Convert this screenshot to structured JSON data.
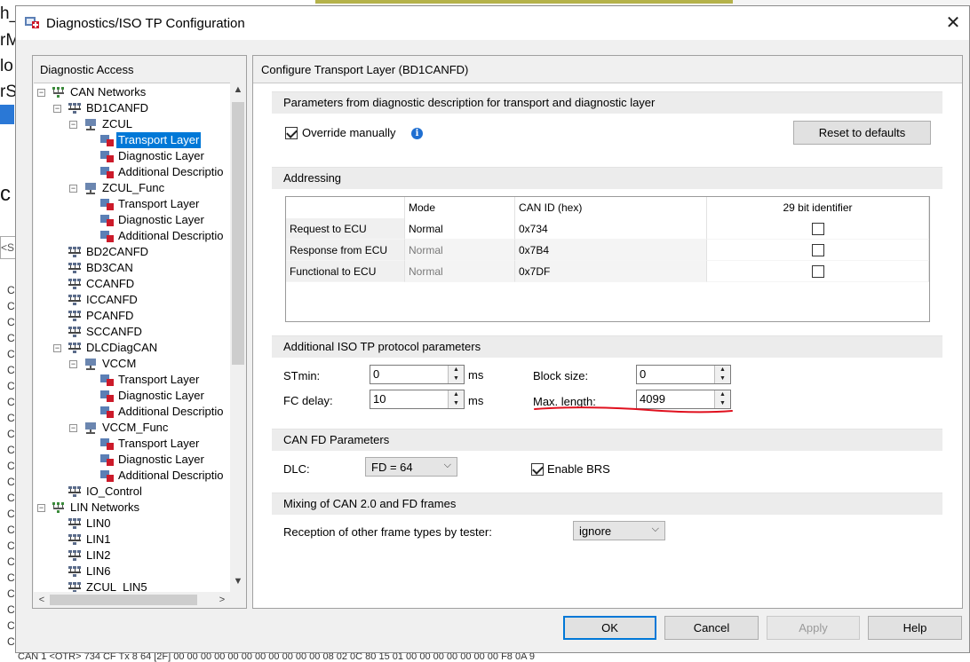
{
  "background": {
    "left_fragments": [
      "h_",
      "rM",
      "lo",
      "rS",
      "c"
    ],
    "combo_fragment": "<S",
    "row_prefix": "C",
    "bottom_row": "CAN 1    <OTR>           734              CF              Tx     8      64     [2F] 00 00 00 00 00 00 00 00 00 00 00 08 02 0C 80 15 01 00 00 00 00 00 00 00 F8 0A 9"
  },
  "dialog": {
    "title": "Diagnostics/ISO TP Configuration",
    "close_glyph": "✕"
  },
  "left_panel": {
    "header": "Diagnostic Access",
    "tree": [
      {
        "label": "CAN Networks",
        "icon": "network-icon",
        "expander": "-"
      },
      {
        "label": "BD1CANFD",
        "icon": "bus-icon",
        "expander": "-"
      },
      {
        "label": "ZCUL",
        "icon": "ecu-icon",
        "expander": "-"
      },
      {
        "label": "Transport Layer",
        "icon": "layer-icon",
        "selected": true
      },
      {
        "label": "Diagnostic Layer",
        "icon": "layer-icon"
      },
      {
        "label": "Additional Descriptio",
        "icon": "layer-icon"
      },
      {
        "label": "ZCUL_Func",
        "icon": "ecu-icon",
        "expander": "-"
      },
      {
        "label": "Transport Layer",
        "icon": "layer-icon"
      },
      {
        "label": "Diagnostic Layer",
        "icon": "layer-icon"
      },
      {
        "label": "Additional Descriptio",
        "icon": "layer-icon"
      },
      {
        "label": "BD2CANFD",
        "icon": "bus-icon"
      },
      {
        "label": "BD3CAN",
        "icon": "bus-icon"
      },
      {
        "label": "CCANFD",
        "icon": "bus-icon"
      },
      {
        "label": "ICCANFD",
        "icon": "bus-icon"
      },
      {
        "label": "PCANFD",
        "icon": "bus-icon"
      },
      {
        "label": "SCCANFD",
        "icon": "bus-icon"
      },
      {
        "label": "DLCDiagCAN",
        "icon": "bus-icon",
        "expander": "-"
      },
      {
        "label": "VCCM",
        "icon": "ecu-icon",
        "expander": "-"
      },
      {
        "label": "Transport Layer",
        "icon": "layer-icon"
      },
      {
        "label": "Diagnostic Layer",
        "icon": "layer-icon"
      },
      {
        "label": "Additional Descriptio",
        "icon": "layer-icon"
      },
      {
        "label": "VCCM_Func",
        "icon": "ecu-icon",
        "expander": "-"
      },
      {
        "label": "Transport Layer",
        "icon": "layer-icon"
      },
      {
        "label": "Diagnostic Layer",
        "icon": "layer-icon"
      },
      {
        "label": "Additional Descriptio",
        "icon": "layer-icon"
      },
      {
        "label": "IO_Control",
        "icon": "bus-icon"
      },
      {
        "label": "LIN Networks",
        "icon": "network-icon",
        "expander": "-"
      },
      {
        "label": "LIN0",
        "icon": "bus-icon"
      },
      {
        "label": "LIN1",
        "icon": "bus-icon"
      },
      {
        "label": "LIN2",
        "icon": "bus-icon"
      },
      {
        "label": "LIN6",
        "icon": "bus-icon"
      },
      {
        "label": "ZCUL_LIN5",
        "icon": "bus-icon"
      }
    ],
    "scroll_up": "▲",
    "scroll_down": "▼",
    "scroll_left": "<",
    "scroll_right": ">"
  },
  "right_panel": {
    "header": "Configure Transport Layer (BD1CANFD)",
    "params_section": "Parameters from diagnostic description for transport and diagnostic layer",
    "override_label": "Override manually",
    "override_checked": true,
    "info_glyph": "i",
    "reset_button": "Reset to defaults",
    "addressing_section": "Addressing",
    "address_table": {
      "headers": [
        "",
        "Mode",
        "CAN ID (hex)",
        "29 bit identifier"
      ],
      "rows": [
        {
          "name": "Request to ECU",
          "mode": "Normal",
          "can_id": "0x734",
          "bit29": false
        },
        {
          "name": "Response from ECU",
          "mode": "Normal",
          "can_id": "0x7B4",
          "bit29": false
        },
        {
          "name": "Functional to ECU",
          "mode": "Normal",
          "can_id": "0x7DF",
          "bit29": false
        }
      ]
    },
    "iso_section": "Additional ISO TP protocol parameters",
    "stmin_label": "STmin:",
    "stmin_value": "0",
    "stmin_unit": "ms",
    "fcdelay_label": "FC delay:",
    "fcdelay_value": "10",
    "fcdelay_unit": "ms",
    "blocksize_label": "Block size:",
    "blocksize_value": "0",
    "maxlen_label": "Max. length:",
    "maxlen_value": "4099",
    "spin_up": "▲",
    "spin_down": "▼",
    "canfd_section": "CAN FD Parameters",
    "dlc_label": "DLC:",
    "dlc_value": "FD = 64",
    "enable_brs_label": "Enable BRS",
    "enable_brs_checked": true,
    "mixing_section": "Mixing of CAN 2.0 and FD frames",
    "reception_label": "Reception of other frame types by tester:",
    "reception_value": "ignore",
    "combo_chevron": "⌵"
  },
  "buttons": {
    "ok": "OK",
    "cancel": "Cancel",
    "apply": "Apply",
    "help": "Help"
  },
  "colors": {
    "selection": "#0078d7",
    "annotation_underline": "#e0101e",
    "info_icon": "#1f6fd1"
  }
}
